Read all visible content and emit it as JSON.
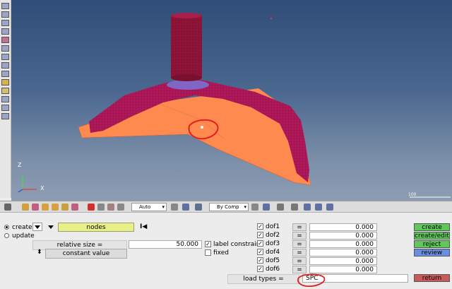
{
  "viewport": {
    "axis_z": "Z",
    "axis_x": "X",
    "scale_label": "100"
  },
  "toolbar": {
    "view_mode": "Auto",
    "color_mode": "By Comp"
  },
  "panel": {
    "create_label": "create",
    "update_label": "update",
    "entity_selector": "nodes",
    "relative_size_label": "relative size =",
    "relative_size_value": "50.000",
    "constant_value_label": "constant value",
    "label_constraint_label": "label constraint",
    "fixed_label": "fixed",
    "dofs": [
      {
        "label": "dof1",
        "eq": "=",
        "value": "0.000",
        "checked": true
      },
      {
        "label": "dof2",
        "eq": "=",
        "value": "0.000",
        "checked": true
      },
      {
        "label": "dof3",
        "eq": "=",
        "value": "0.000",
        "checked": true
      },
      {
        "label": "dof4",
        "eq": "=",
        "value": "0.000",
        "checked": true
      },
      {
        "label": "dof5",
        "eq": "=",
        "value": "0.000",
        "checked": true
      },
      {
        "label": "dof6",
        "eq": "=",
        "value": "0.000",
        "checked": true
      }
    ],
    "load_types_label": "load types =",
    "load_types_value": "SPC",
    "buttons": {
      "create": "create",
      "create_edit": "create/edit",
      "reject": "reject",
      "review": "review",
      "return": "return"
    }
  },
  "colors": {
    "part_orange": "#ff8a50",
    "part_magenta": "#b0185a",
    "punch": "#8e1438",
    "annotation_red": "#e02020",
    "btn_green": "#5ec85a",
    "btn_blue": "#6a8fe0",
    "btn_red": "#c85a5a"
  }
}
